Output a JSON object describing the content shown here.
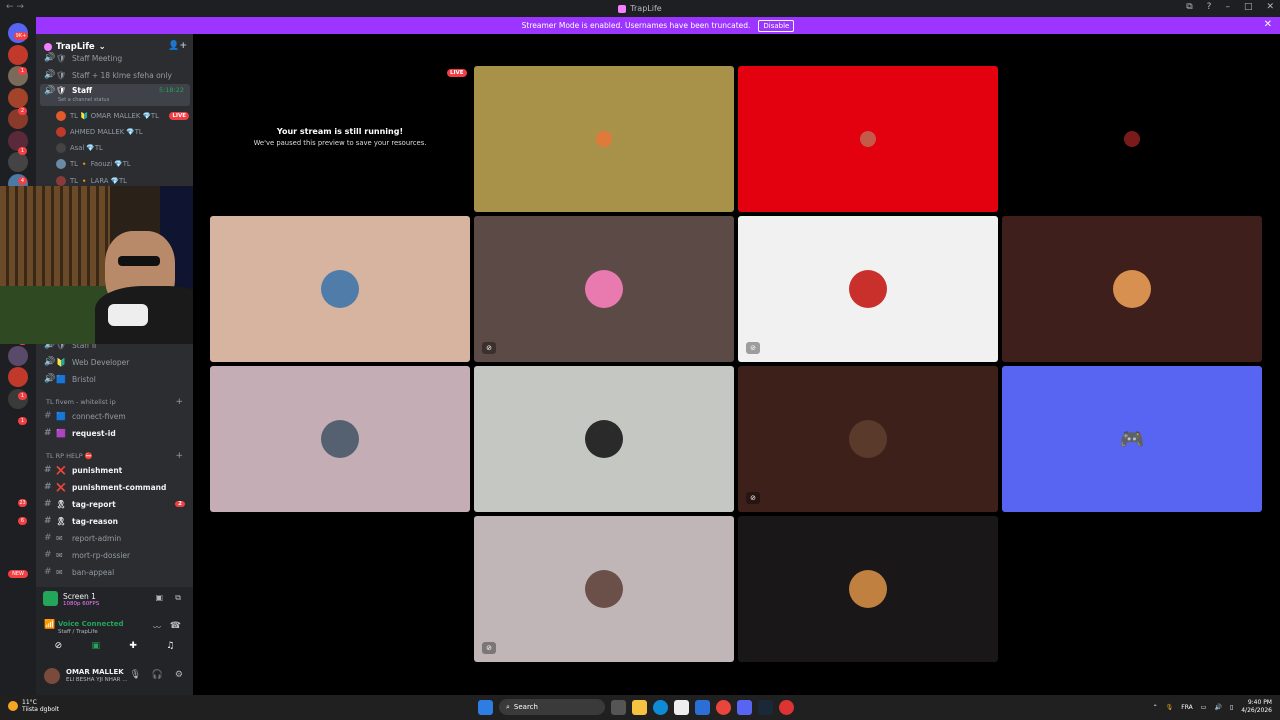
{
  "window": {
    "title": "TrapLife",
    "nav_back": "←",
    "nav_forward": "→",
    "controls": [
      "⧉",
      "?",
      "–",
      "□",
      "✕"
    ]
  },
  "banner": {
    "text": "Streamer Mode is enabled. Usernames have been truncated.",
    "button": "Disable",
    "close": "✕"
  },
  "guilds": {
    "badges": [
      "9K+",
      "1",
      "2",
      "1",
      "4",
      "1",
      "1",
      "1",
      "1",
      "1",
      "23",
      "6"
    ],
    "new_label": "NEW"
  },
  "server": {
    "name": "TrapLife",
    "chevron": "⌄",
    "invite_icon": "👤+"
  },
  "channels_top": [
    {
      "name": "Staff Meeting",
      "emoji": "🛡"
    },
    {
      "name": "Staff + 18 klme sfeha only",
      "emoji": "🛡"
    }
  ],
  "active_channel": {
    "name": "Staff",
    "emoji": "🛡",
    "status_hint": "Set a channel status",
    "time": "5:18:22"
  },
  "voice_users": [
    {
      "name": "TL 🔰 OMAR MALLEK 💎TL",
      "live": "LIVE",
      "color": "#e05a2b"
    },
    {
      "name": "AHMED MALLEK 💎TL",
      "live": "",
      "color": "#c0392b"
    },
    {
      "name": "Asal 💎TL",
      "live": "",
      "color": "#444"
    },
    {
      "name": "TL 🔸 Faouzi 💎TL",
      "live": "",
      "color": "#6b8aa6"
    },
    {
      "name": "TL 🔸 LARA 💎TL",
      "live": "",
      "color": "#8b3a3a"
    }
  ],
  "channels_mid": [
    {
      "name": "Staff II",
      "emoji": "🛡"
    },
    {
      "name": "Web Developer",
      "emoji": "🔰"
    },
    {
      "name": "Bristol",
      "emoji": "🟦"
    }
  ],
  "category_1": "TL fivem - whitelist ip",
  "category_1_items": [
    {
      "name": "connect-fivem",
      "emoji": "🟦",
      "bold": false
    },
    {
      "name": "request-id",
      "emoji": "🟪",
      "bold": true
    }
  ],
  "category_2": "TL RP HELP ⛔",
  "category_2_items": [
    {
      "name": "punishment",
      "emoji": "❌",
      "bold": true,
      "badge": ""
    },
    {
      "name": "punishment-command",
      "emoji": "❌",
      "bold": true,
      "badge": ""
    },
    {
      "name": "tag-report",
      "emoji": "🎗",
      "bold": true,
      "badge": "2"
    },
    {
      "name": "tag-reason",
      "emoji": "🎗",
      "bold": true,
      "badge": ""
    },
    {
      "name": "report-admin",
      "emoji": "✉",
      "bold": false,
      "badge": ""
    },
    {
      "name": "mort-rp-dossier",
      "emoji": "✉",
      "bold": false,
      "badge": ""
    },
    {
      "name": "ban-appeal",
      "emoji": "✉",
      "bold": false,
      "badge": ""
    }
  ],
  "screen_share": {
    "title": "Screen 1",
    "subtitle": "1080p 60FPS"
  },
  "voice": {
    "status": "Voice Connected",
    "location": "Staff / TrapLife"
  },
  "user": {
    "name": "OMAR MALLEK",
    "status": "ELI BESHA YJI NHAR ..."
  },
  "stream": {
    "live": "LIVE",
    "title": "Your stream is still running!",
    "subtitle": "We've paused this preview to save your resources."
  },
  "tiles": [
    {
      "bg": "#a8924a",
      "avatar": "#e07a3a",
      "muted": false
    },
    {
      "bg": "#e3000f",
      "avatar": "#c45a4a",
      "muted": false
    },
    {
      "bg": "#000000",
      "avatar": "#7a1a1a",
      "muted": false
    },
    {
      "bg": "#d6b4a0",
      "avatar": "#4f7ca8",
      "muted": false
    },
    {
      "bg": "#5c4a46",
      "avatar": "#e87ab0",
      "muted": true
    },
    {
      "bg": "#f2f1f1",
      "avatar": "#c9302c",
      "muted": true
    },
    {
      "bg": "#3f1f1c",
      "avatar": "#d89050",
      "muted": false
    },
    {
      "bg": "#c4adb5",
      "avatar": "#556070",
      "muted": false
    },
    {
      "bg": "#c5c8c2",
      "avatar": "#2a2a2a",
      "muted": false
    },
    {
      "bg": "#3e201a",
      "avatar": "#5a3a2a",
      "muted": true
    },
    {
      "bg": "#5865f2",
      "avatar": "#5865f2",
      "muted": false
    },
    {
      "bg": "#c1b6b7",
      "avatar": "#6a5048",
      "muted": true
    },
    {
      "bg": "#1a1718",
      "avatar": "#c08040",
      "muted": false
    }
  ],
  "taskbar": {
    "temp": "11°C",
    "weather": "Tiista dgbolt",
    "search": "Search",
    "lang": "FRA",
    "time": "9:40 PM",
    "date": "4/26/2026"
  }
}
